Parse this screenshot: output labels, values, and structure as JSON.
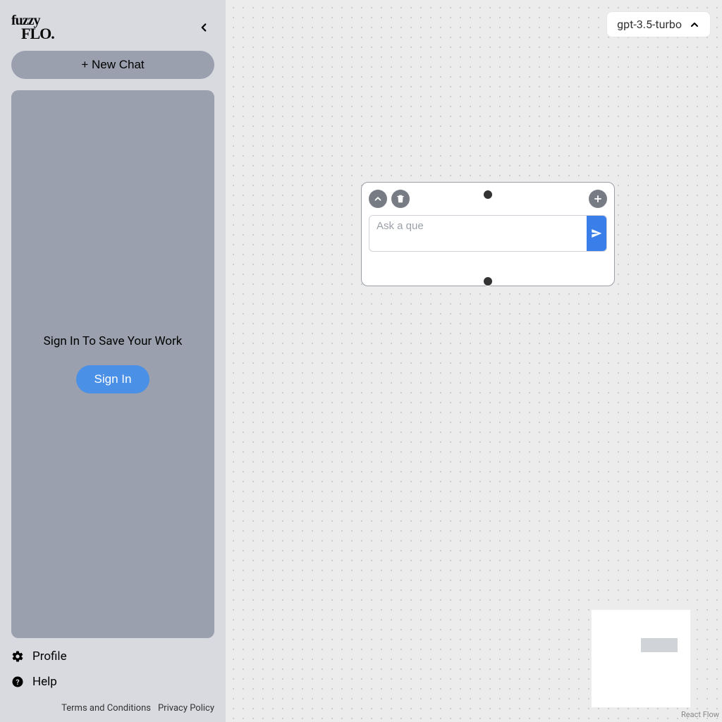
{
  "sidebar": {
    "logo_top": "fuzzy",
    "logo_bottom": "FLO.",
    "new_chat_label": "+ New Chat",
    "sign_in_prompt": "Sign In To Save Your Work",
    "sign_in_button": "Sign In",
    "profile_label": "Profile",
    "help_label": "Help",
    "terms_label": "Terms and Conditions",
    "privacy_label": "Privacy Policy"
  },
  "toolbar": {
    "model_selected": "gpt-3.5-turbo"
  },
  "node": {
    "input_placeholder": "Ask a que",
    "input_value": ""
  },
  "canvas": {
    "attribution": "React Flow"
  }
}
